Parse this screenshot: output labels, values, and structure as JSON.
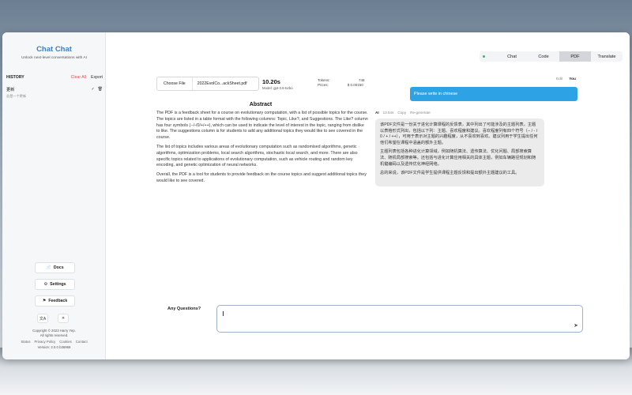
{
  "app": {
    "title": "Chat Chat",
    "subtitle": "Unlock next-level conversations with AI"
  },
  "history": {
    "heading": "HISTORY",
    "clear_label": "Clear All",
    "export_label": "Export",
    "items": [
      {
        "title": "更新",
        "subtitle": "总是一个更新",
        "check_icon": "✓",
        "delete_icon": "🗑"
      }
    ]
  },
  "sidebar_buttons": {
    "docs": "Docs",
    "settings": "Settings",
    "feedback": "Feedback",
    "docs_icon": "📄",
    "settings_icon": "⚙",
    "feedback_icon": "⚑",
    "translate_icon": "文A",
    "theme_icon": "☀"
  },
  "footer": {
    "copyright": "Copyright © 2023 Harry Yep.",
    "rights": "All rights reserved.",
    "links": [
      "Status",
      "Privacy Policy",
      "Cookies",
      "Contact"
    ],
    "version": "Version: 2.0.0   b36969"
  },
  "tabs": [
    {
      "label": "Chat",
      "active": false
    },
    {
      "label": "Code",
      "active": false
    },
    {
      "label": "PDF",
      "active": true
    },
    {
      "label": "Translate",
      "active": false
    }
  ],
  "file": {
    "choose_label": "Choose File",
    "file_name": "2022EvolCo...ackSheet.pdf",
    "time": "10.20s",
    "model": "Model: gpt-3.5-turbo",
    "tokens_label": "Tokens:",
    "tokens_value": "748",
    "prices_label": "Prices:",
    "prices_value": "$ 0.00150"
  },
  "abstract": {
    "title": "Abstract",
    "paragraphs": [
      "The PDF is a feedback sheet for a course on evolutionary computation, with a list of possible topics for the course. The topics are listed in a table format with the following columns: Topic, Like?, and Suggestions. The Like? column has four symbols (--/-/0/+/++), which can be used to indicate the level of interest in the topic, ranging from dislike to like. The suggestions column is for students to add any additional topics they would like to see covered in the course.",
      "The list of topics includes various areas of evolutionary computation such as randomised algorithms, genetic algorithms, optimization problems, local search algorithms, stochastic local search, and more. There are also specific topics related to applications of evolutionary computation, such as vehicle routing and random key encoding, and genetic optimization of neural networks.",
      "Overall, the PDF is a tool for students to provide feedback on the course topics and suggest additional topics they would like to see covered."
    ]
  },
  "user_message": {
    "edit_label": "Edit",
    "author": "You",
    "text": "Please write in chinese"
  },
  "ai_message": {
    "author": "AI",
    "time": "13.54s",
    "copy_label": "Copy",
    "regenerate_label": "Re-generate",
    "paragraphs": [
      "该PDF文件是一份关于进化计算课程的反馈表，其中列出了可能涉及的主题列表。主题以表格形式列出，包括以下列：主题、喜欢程度和建议。喜欢程度列有四个符号（-- / - / 0 / + / ++），可用于表示对主题的兴趣程度，从不喜欢到喜欢。建议列用于学生提出任何他们希望在课程中涵盖的额外主题。",
      "主题列表包括各种进化计算领域，例如随机算法、遗传算法、优化问题、局部搜索算法、随机局部搜索等。还包括与进化计算应用相关的具体主题，例如车辆路径规划和随机键编码以及遗传优化神经网络。",
      "总的来说，该PDF文件是学生提供课程主题反馈和提出额外主题建议的工具。"
    ]
  },
  "question": {
    "label": "Any Questions?",
    "placeholder": ""
  }
}
